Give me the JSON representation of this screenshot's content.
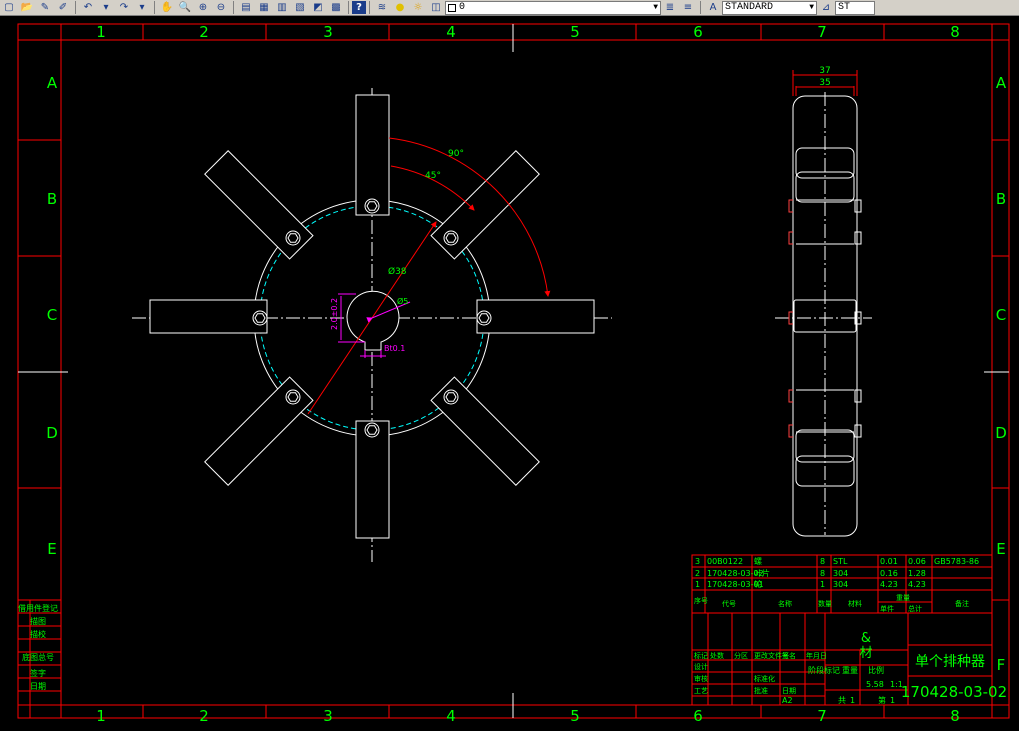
{
  "toolbar": {
    "layer_value": "0",
    "text_style_value": "STANDARD",
    "dim_style_value": "ST",
    "help_label": "?"
  },
  "colors": {
    "background": "#000000",
    "frame": "#ff0000",
    "geometry": "#ffffff",
    "text": "#00ff00",
    "dimension_magenta": "#ff00ff",
    "pitch_circle": "#00ffff",
    "leader_red": "#ff0000"
  },
  "border_zones": {
    "columns": [
      "1",
      "2",
      "3",
      "4",
      "5",
      "6",
      "7",
      "8"
    ],
    "rows": [
      "A",
      "B",
      "C",
      "D",
      "E",
      "F"
    ]
  },
  "front_view": {
    "dim_angle_90": "90°",
    "dim_angle_45": "45°",
    "dim_dia_pitch": "Ø38",
    "dim_dia_bore": "Ø5",
    "dim_keyway_depth": "2.0±0.2",
    "dim_keyway_width": "Bt0.1"
  },
  "side_view": {
    "dim_outer": "37",
    "dim_inner": "35"
  },
  "parts_list": {
    "rows": [
      {
        "no": "3",
        "code": "00B0122",
        "name": "螺",
        "qty": "8",
        "material": "STL",
        "unit_wt": "0.01",
        "total_wt": "0.06",
        "remark": "GB5783-86"
      },
      {
        "no": "2",
        "code": "170428-03-02",
        "name": "叶片",
        "qty": "8",
        "material": "304",
        "unit_wt": "0.16",
        "total_wt": "1.28",
        "remark": ""
      },
      {
        "no": "1",
        "code": "170428-03-01",
        "name": "轮",
        "qty": "1",
        "material": "304",
        "unit_wt": "4.23",
        "total_wt": "4.23",
        "remark": ""
      }
    ],
    "header": {
      "no": "序号",
      "code": "代号",
      "name": "名称",
      "qty": "数量",
      "material": "材料",
      "unit_wt": "单件",
      "total_wt": "总计",
      "remark": "备注",
      "weight": "重量"
    }
  },
  "title_block": {
    "material_symbol": "&",
    "material_label": "材",
    "drawing_title": "单个排种器",
    "drawing_number": "170428-03-02",
    "scale_label": "比例",
    "scale_value": "1:1",
    "sheet_label": "共",
    "sheet_total": "1",
    "page_label": "第",
    "page_value": "1",
    "stage_label": "阶段标记",
    "weight_label": "重量",
    "weight_value": "5.58",
    "format_value": "A2",
    "change_labels": [
      "标记",
      "处数",
      "分区",
      "更改文件号",
      "签名",
      "年月日"
    ],
    "sign_labels": [
      "设计",
      "审核",
      "工艺",
      "标准化",
      "批准",
      "日期"
    ]
  },
  "left_strip": {
    "labels": [
      "借用件登记",
      "描图",
      "描校",
      "底图总号",
      "签字",
      "日期"
    ]
  }
}
